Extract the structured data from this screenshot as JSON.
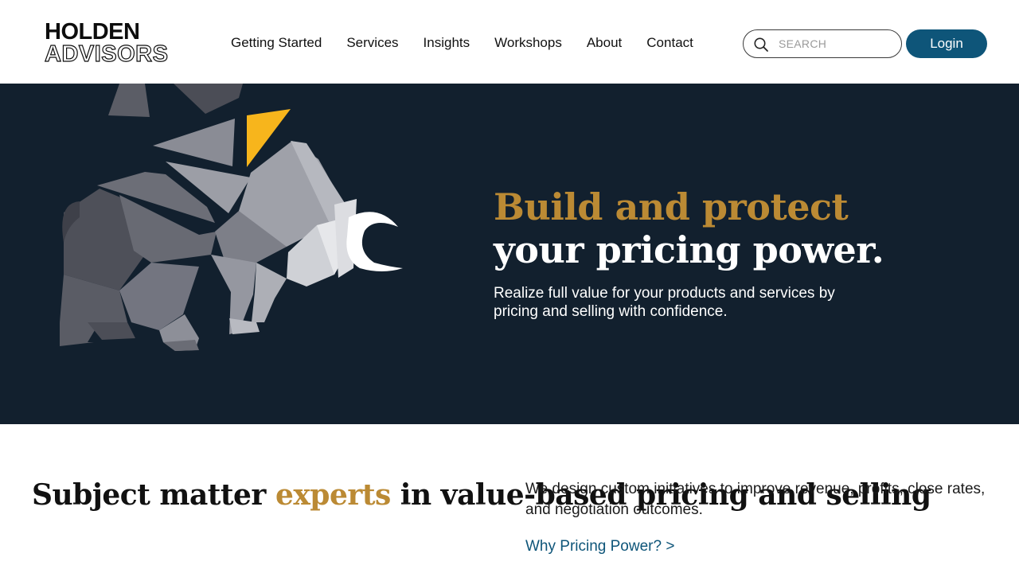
{
  "brand": {
    "line1": "HOLDEN",
    "line2": "ADVISORS"
  },
  "nav": {
    "items": [
      {
        "label": "Getting Started"
      },
      {
        "label": "Services"
      },
      {
        "label": "Insights"
      },
      {
        "label": "Workshops"
      },
      {
        "label": "About"
      },
      {
        "label": "Contact"
      }
    ]
  },
  "search": {
    "placeholder": "SEARCH",
    "icon": "search-icon"
  },
  "login": {
    "label": "Login"
  },
  "hero": {
    "title_line1": "Build and protect",
    "title_line2": "your pricing power.",
    "subtitle": "Realize full value for your products and services by pricing and selling with confidence.",
    "illustration": "geometric-bull-illustration"
  },
  "intro": {
    "heading_before": "Subject matter ",
    "heading_accent": "experts",
    "heading_after": " in value-based pricing and selling",
    "body": "We design custom initiatives to improve revenue, profits, close rates, and negotiation outcomes.",
    "link": "Why Pricing Power? >"
  },
  "colors": {
    "accent_gold": "#bb8a34",
    "hero_bg": "#12202e",
    "brand_blue": "#0e5579",
    "shard_yellow": "#f7b51c"
  }
}
